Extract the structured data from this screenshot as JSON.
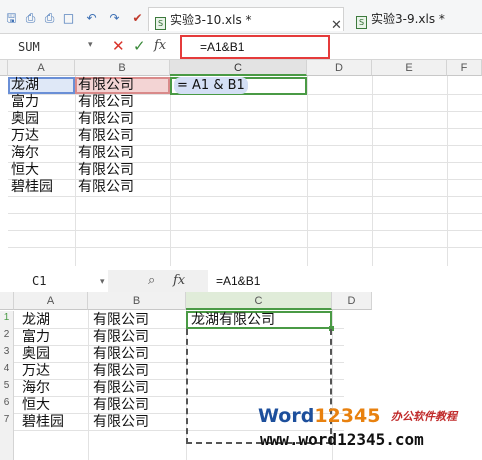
{
  "top": {
    "tabs": [
      {
        "label": "实验3-10.xls *",
        "active": true
      },
      {
        "label": "实验3-9.xls *",
        "active": false
      }
    ],
    "fx": "fx",
    "name_box": "SUM",
    "formula": "=A1&B1",
    "columns": [
      "A",
      "B",
      "C",
      "D",
      "E",
      "F"
    ],
    "rows": [
      {
        "a": "龙湖",
        "b": "有限公司",
        "c": "= A1 & B1"
      },
      {
        "a": "富力",
        "b": "有限公司",
        "c": ""
      },
      {
        "a": "奥园",
        "b": "有限公司",
        "c": ""
      },
      {
        "a": "万达",
        "b": "有限公司",
        "c": ""
      },
      {
        "a": "海尔",
        "b": "有限公司",
        "c": ""
      },
      {
        "a": "恒大",
        "b": "有限公司",
        "c": ""
      },
      {
        "a": "碧桂园",
        "b": "有限公司",
        "c": ""
      }
    ]
  },
  "bottom": {
    "name_box": "C1",
    "fx": "fx",
    "formula": "=A1&B1",
    "columns": [
      "A",
      "B",
      "C",
      "D"
    ],
    "row_numbers": [
      "1",
      "2",
      "3",
      "4",
      "5",
      "6",
      "7"
    ],
    "rows": [
      {
        "a": "龙湖",
        "b": "有限公司",
        "c": "龙湖有限公司"
      },
      {
        "a": "富力",
        "b": "有限公司",
        "c": ""
      },
      {
        "a": "奥园",
        "b": "有限公司",
        "c": ""
      },
      {
        "a": "万达",
        "b": "有限公司",
        "c": ""
      },
      {
        "a": "海尔",
        "b": "有限公司",
        "c": ""
      },
      {
        "a": "恒大",
        "b": "有限公司",
        "c": ""
      },
      {
        "a": "碧桂园",
        "b": "有限公司",
        "c": ""
      }
    ]
  },
  "watermark": {
    "brand_word": "Word",
    "brand_num": "12345",
    "brand_tag": "办公软件教程",
    "url": "www.word12345.com"
  }
}
